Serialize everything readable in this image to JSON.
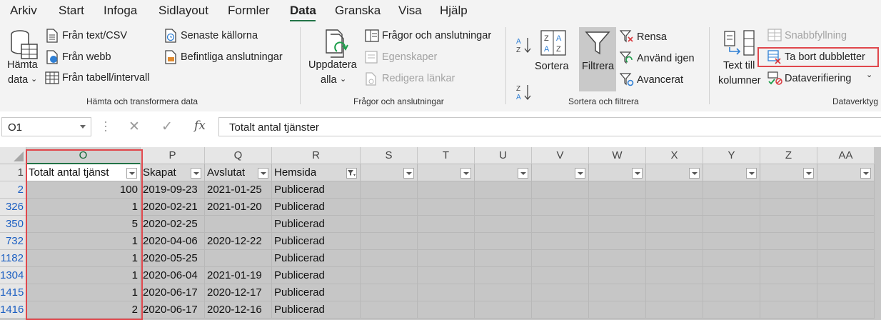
{
  "tabs": [
    "Arkiv",
    "Start",
    "Infoga",
    "Sidlayout",
    "Formler",
    "Data",
    "Granska",
    "Visa",
    "Hjälp"
  ],
  "active_tab": "Data",
  "ribbon": {
    "get_transform": {
      "hamta_line1": "Hämta",
      "hamta_line2": "data",
      "from_text": "Från text/CSV",
      "from_web": "Från webb",
      "from_table": "Från tabell/intervall",
      "recent_sources": "Senaste källorna",
      "existing_connections": "Befintliga anslutningar",
      "label": "Hämta och transformera data"
    },
    "queries": {
      "refresh_line1": "Uppdatera",
      "refresh_line2": "alla",
      "queries_connections": "Frågor och anslutningar",
      "properties": "Egenskaper",
      "edit_links": "Redigera länkar",
      "label": "Frågor och anslutningar"
    },
    "sort_filter": {
      "sort": "Sortera",
      "filter": "Filtrera",
      "clear": "Rensa",
      "reapply": "Använd igen",
      "advanced": "Avancerat",
      "label": "Sortera och filtrera"
    },
    "data_tools": {
      "text_to_columns_line1": "Text till",
      "text_to_columns_line2": "kolumner",
      "flash_fill": "Snabbfyllning",
      "remove_duplicates": "Ta bort dubbletter",
      "data_validation": "Dataverifiering",
      "label": "Dataverktyg"
    }
  },
  "formula_bar": {
    "name_box": "O1",
    "cancel": "✕",
    "enter": "✓",
    "fx": "fx",
    "value": "Totalt antal tjänster"
  },
  "grid": {
    "columns": [
      "O",
      "P",
      "Q",
      "R",
      "S",
      "T",
      "U",
      "V",
      "W",
      "X",
      "Y",
      "Z",
      "AA"
    ],
    "header_row": [
      "Totalt antal tjänst",
      "Skapat",
      "Avslutat",
      "Hemsida"
    ],
    "rows": [
      {
        "row": "1",
        "cells": []
      },
      {
        "row": "2",
        "cells": [
          "100",
          "2019-09-23",
          "2021-01-25",
          "Publicerad"
        ]
      },
      {
        "row": "326",
        "cells": [
          "1",
          "2020-02-21",
          "2021-01-20",
          "Publicerad"
        ]
      },
      {
        "row": "350",
        "cells": [
          "5",
          "2020-02-25",
          "",
          "Publicerad"
        ]
      },
      {
        "row": "732",
        "cells": [
          "1",
          "2020-04-06",
          "2020-12-22",
          "Publicerad"
        ]
      },
      {
        "row": "1182",
        "cells": [
          "1",
          "2020-05-25",
          "",
          "Publicerad"
        ]
      },
      {
        "row": "1304",
        "cells": [
          "1",
          "2020-06-04",
          "2021-01-19",
          "Publicerad"
        ]
      },
      {
        "row": "1415",
        "cells": [
          "1",
          "2020-06-17",
          "2020-12-17",
          "Publicerad"
        ]
      },
      {
        "row": "1416",
        "cells": [
          "2",
          "2020-06-17",
          "2020-12-16",
          "Publicerad"
        ]
      }
    ]
  },
  "colors": {
    "accent": "#217346",
    "highlight": "#e0474c",
    "row_link": "#1c5fc2",
    "grid_gray": "#c6c6c6"
  }
}
